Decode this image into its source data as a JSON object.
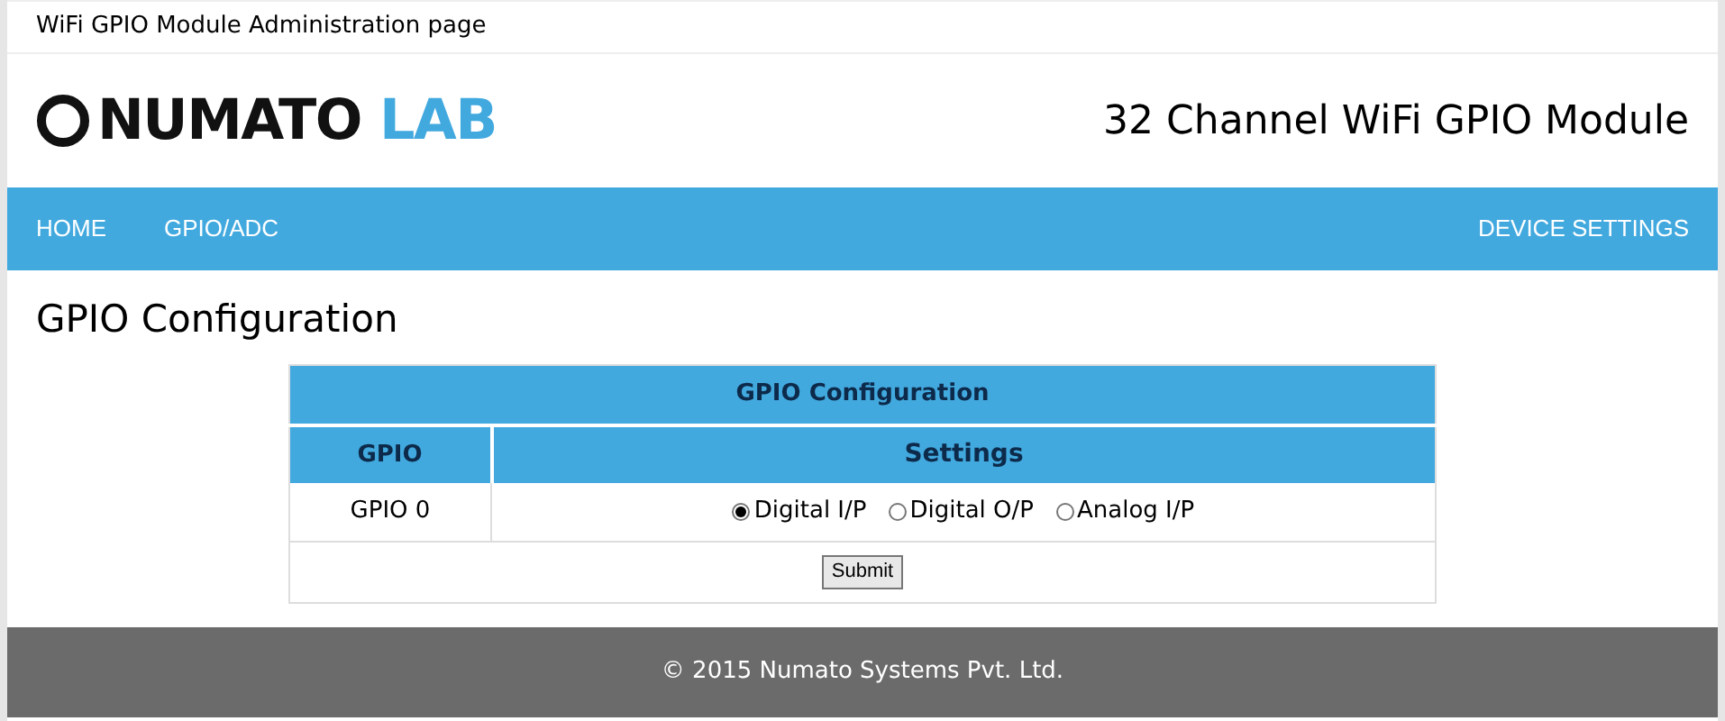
{
  "window": {
    "title": "WiFi GPIO Module Administration page"
  },
  "logo": {
    "primary": "NUMATO",
    "accent": "LAB"
  },
  "header_title": "32 Channel WiFi GPIO Module",
  "nav": {
    "left": [
      {
        "label": "HOME"
      },
      {
        "label": "GPIO/ADC"
      }
    ],
    "right": [
      {
        "label": "DEVICE SETTINGS"
      }
    ]
  },
  "page_heading": "GPIO Configuration",
  "table": {
    "title": "GPIO Configuration",
    "columns": [
      "GPIO",
      "Settings"
    ],
    "rows": [
      {
        "gpio": "GPIO 0",
        "options": [
          {
            "label": "Digital I/P",
            "selected": true
          },
          {
            "label": "Digital O/P",
            "selected": false
          },
          {
            "label": "Analog I/P",
            "selected": false
          }
        ]
      }
    ],
    "submit": "Submit"
  },
  "footer": "© 2015 Numato Systems Pvt. Ltd."
}
